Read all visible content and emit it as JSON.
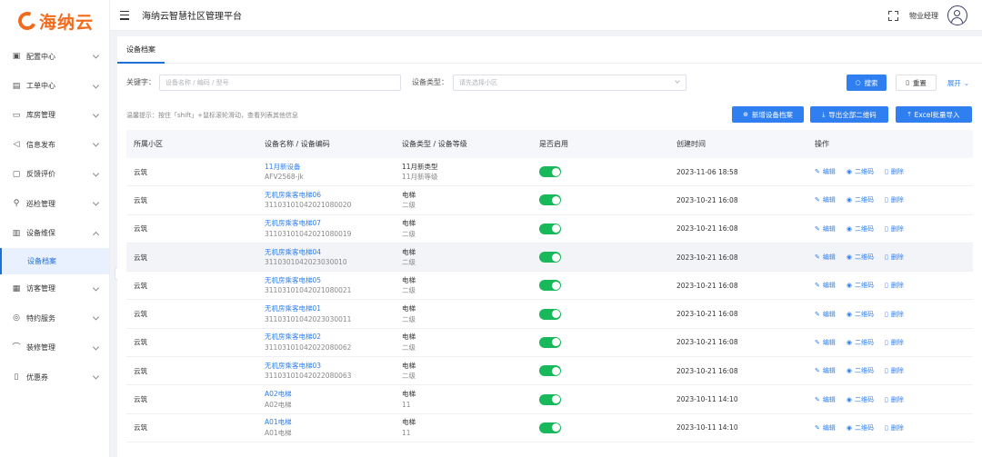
{
  "app": {
    "logo_text": "海纳云",
    "title": "海纳云智慧社区管理平台",
    "user_name": "物业经理"
  },
  "sidebar": {
    "items": [
      {
        "label": "配置中心",
        "icon": "settings-icon",
        "expanded": false
      },
      {
        "label": "工单中心",
        "icon": "ticket-icon",
        "expanded": false
      },
      {
        "label": "库房管理",
        "icon": "warehouse-icon",
        "expanded": false
      },
      {
        "label": "信息发布",
        "icon": "send-icon",
        "expanded": false
      },
      {
        "label": "反馈评价",
        "icon": "feedback-icon",
        "expanded": false
      },
      {
        "label": "巡检管理",
        "icon": "patrol-icon",
        "expanded": false
      },
      {
        "label": "设备维保",
        "icon": "device-icon",
        "expanded": true
      },
      {
        "label": "访客管理",
        "icon": "visitor-icon",
        "expanded": false
      },
      {
        "label": "特约服务",
        "icon": "service-icon",
        "expanded": false
      },
      {
        "label": "装修管理",
        "icon": "decoration-icon",
        "expanded": false
      },
      {
        "label": "优惠券",
        "icon": "coupon-icon",
        "expanded": false
      }
    ],
    "active_sub": "设备档案"
  },
  "tabs": [
    {
      "label": "设备档案",
      "active": true
    }
  ],
  "filter": {
    "keyword_label": "关键字：",
    "keyword_placeholder": "设备名称 / 编码 / 型号",
    "type_label": "设备类型：",
    "type_placeholder": "请先选择小区",
    "search_label": "搜索",
    "reset_label": "重置",
    "expand_label": "展开"
  },
  "tip": "温馨提示：按住「shift」+鼠标滚轮滑动，查看列表其他信息",
  "actions": {
    "add_label": "新增设备档案",
    "export_label": "导出全部二维码",
    "import_label": "Excel批量导入"
  },
  "table": {
    "headers": [
      "所属小区",
      "设备名称 / 设备编码",
      "设备类型 / 设备等级",
      "是否启用",
      "创建时间",
      "操作"
    ],
    "op_labels": {
      "edit": "编辑",
      "qrcode": "二维码",
      "delete": "删除"
    },
    "rows": [
      {
        "community": "云筑",
        "name": "11月新设备",
        "code": "AFV2568-jk",
        "type": "11月新类型",
        "level": "11月新等级",
        "enabled": true,
        "created": "2023-11-06 18:58"
      },
      {
        "community": "云筑",
        "name": "无机房乘客电梯06",
        "code": "3110310104202108​0020",
        "type": "电梯",
        "level": "二级",
        "enabled": true,
        "created": "2023-10-21 16:08"
      },
      {
        "community": "云筑",
        "name": "无机房乘客电梯07",
        "code": "31103101042021080019",
        "type": "电梯",
        "level": "二级",
        "enabled": true,
        "created": "2023-10-21 16:08"
      },
      {
        "community": "云筑",
        "name": "无机房乘客电梯04",
        "code": "31103010420230300​10",
        "type": "电梯",
        "level": "二级",
        "enabled": true,
        "created": "2023-10-21 16:08"
      },
      {
        "community": "云筑",
        "name": "无机房乘客电梯05",
        "code": "31103101042021080021",
        "type": "电梯",
        "level": "二级",
        "enabled": true,
        "created": "2023-10-21 16:08"
      },
      {
        "community": "云筑",
        "name": "无机房乘客电梯01",
        "code": "31103101042023030011",
        "type": "电梯",
        "level": "二级",
        "enabled": true,
        "created": "2023-10-21 16:08"
      },
      {
        "community": "云筑",
        "name": "无机房乘客电梯02",
        "code": "31103101042022080062",
        "type": "电梯",
        "level": "二级",
        "enabled": true,
        "created": "2023-10-21 16:08"
      },
      {
        "community": "云筑",
        "name": "无机房乘客电梯03",
        "code": "31103101042022080063",
        "type": "电梯",
        "level": "二级",
        "enabled": true,
        "created": "2023-10-21 16:08"
      },
      {
        "community": "云筑",
        "name": "A02电梯",
        "code": "A02电梯",
        "type": "电梯",
        "level": "11",
        "enabled": true,
        "created": "2023-10-11 14:10"
      },
      {
        "community": "云筑",
        "name": "A01电梯",
        "code": "A01电梯",
        "type": "电梯",
        "level": "11",
        "enabled": true,
        "created": "2023-10-11 14:10"
      }
    ]
  },
  "colors": {
    "accent": "#2f7ff0",
    "brand": "#f26b1d",
    "toggle_on": "#19b85a"
  }
}
